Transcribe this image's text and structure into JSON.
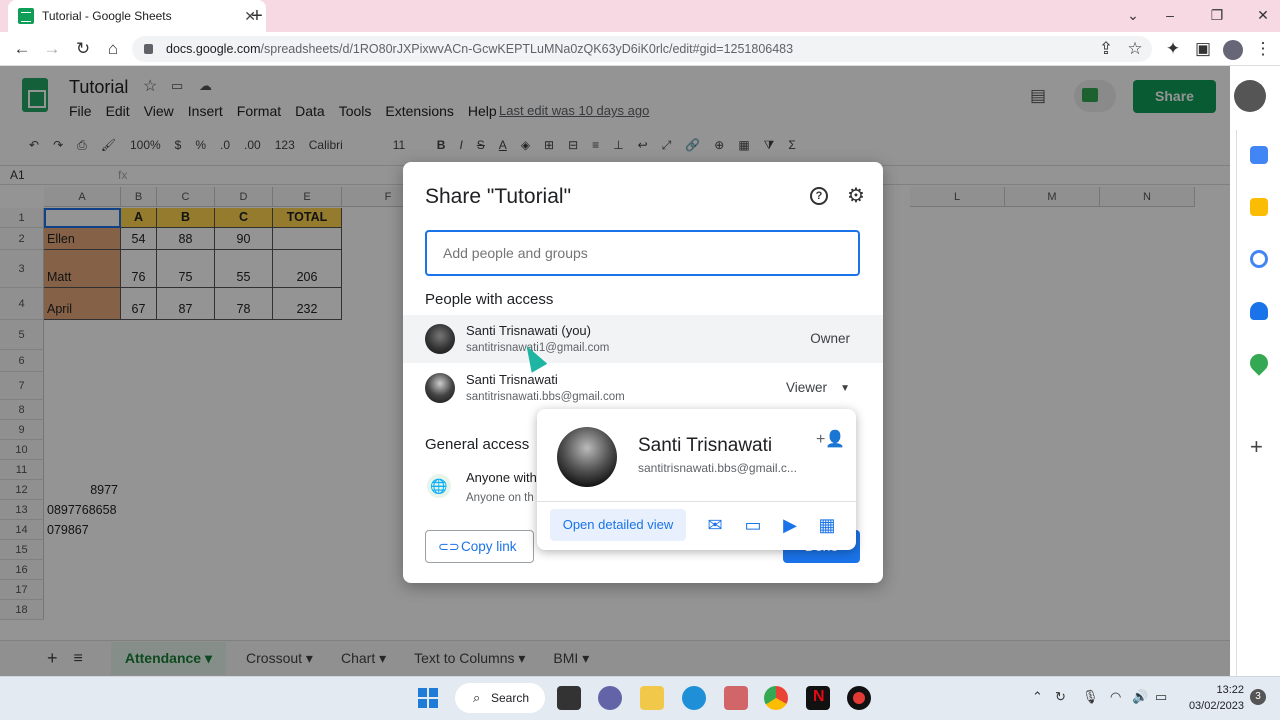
{
  "browser": {
    "tab_title": "Tutorial - Google Sheets",
    "tab_close": "✕",
    "new_tab": "+",
    "url_host": "docs.google.com",
    "url_path": "/spreadsheets/d/1RO80rJXPixwvACn-GcwKEPTLuMNa0zQK63yD6iK0rlc/edit#gid=1251806483"
  },
  "sheets": {
    "doc_title": "Tutorial",
    "menus": [
      "File",
      "Edit",
      "View",
      "Insert",
      "Format",
      "Data",
      "Tools",
      "Extensions",
      "Help"
    ],
    "last_edit": "Last edit was 10 days ago",
    "share_label": "Share",
    "toolbar": [
      "100%",
      "$",
      "%",
      ".0",
      ".00",
      "123",
      "Calibri",
      "11",
      "B",
      "I",
      "S",
      "A"
    ],
    "cell_ref": "A1",
    "columns": [
      "A",
      "B",
      "C",
      "D",
      "E",
      "F",
      "L",
      "M",
      "N"
    ],
    "rows": [
      "1",
      "2",
      "3",
      "4",
      "5",
      "6",
      "7",
      "8",
      "9",
      "10",
      "11",
      "12",
      "13",
      "14",
      "15",
      "16",
      "17",
      "18"
    ],
    "table": {
      "headers": [
        "",
        "A",
        "B",
        "C",
        "TOTAL"
      ],
      "data": [
        [
          "Ellen",
          "54",
          "88",
          "90",
          ""
        ],
        [
          "Matt",
          "76",
          "75",
          "55",
          "206"
        ],
        [
          "April",
          "67",
          "87",
          "78",
          "232"
        ]
      ]
    },
    "extra_cells": [
      "8977",
      "0897768658",
      "079867"
    ],
    "sheet_tabs": [
      "Attendance",
      "Crossout",
      "Chart",
      "Text to Columns",
      "BMI"
    ]
  },
  "dialog": {
    "title": "Share \"Tutorial\"",
    "add_placeholder": "Add people and groups",
    "people_heading": "People with access",
    "people": [
      {
        "name": "Santi Trisnawati (you)",
        "email": "santitrisnawati1@gmail.com",
        "role": "Owner"
      },
      {
        "name": "Santi Trisnawati",
        "email": "santitrisnawati.bbs@gmail.com",
        "role": "Viewer"
      }
    ],
    "general_access_heading": "General access",
    "anyone_label": "Anyone with",
    "anyone_sub": "Anyone on th",
    "copy_link": "Copy link",
    "done": "Done"
  },
  "hovercard": {
    "name": "Santi Trisnawati",
    "email": "santitrisnawati.bbs@gmail.c...",
    "open_detail": "Open detailed view"
  },
  "taskbar": {
    "search": "Search",
    "time": "13:22",
    "date": "03/02/2023",
    "notifications": "3"
  },
  "colors": {
    "accent": "#1a73e8",
    "sheets_green": "#0f9d58",
    "header_yellow": "#ffd54f",
    "name_orange": "#e6a87a"
  }
}
